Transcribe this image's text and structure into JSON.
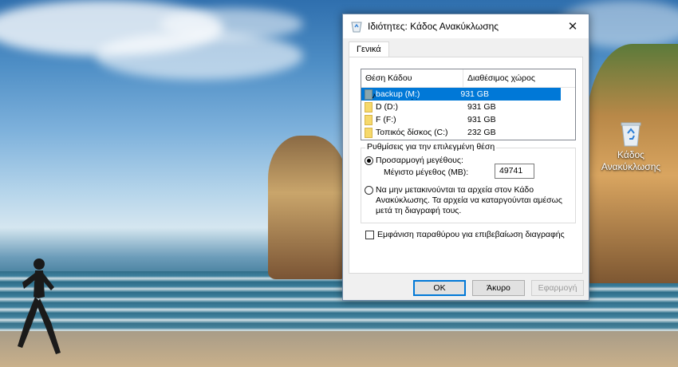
{
  "desktop": {
    "recycle_bin_icon_label": "Κάδος Ανακύκλωσης"
  },
  "dialog": {
    "title": "Ιδιότητες: Κάδος Ανακύκλωσης",
    "tab_general": "Γενικά",
    "list": {
      "col_location": "Θέση Κάδου Ανακύκλωσης",
      "col_space": "Διαθέσιμος χώρος",
      "rows": [
        {
          "name": "backup (M:)",
          "space": "931 GB",
          "selected": true
        },
        {
          "name": "D (D:)",
          "space": "931 GB",
          "selected": false
        },
        {
          "name": "F (F:)",
          "space": "931 GB",
          "selected": false
        },
        {
          "name": "Τοπικός δίσκος (C:)",
          "space": "232 GB",
          "selected": false
        }
      ]
    },
    "settings": {
      "group_title": "Ρυθμίσεις για την επιλεγμένη θέση",
      "custom_size_label": "Προσαρμογή μεγέθους:",
      "max_size_label": "Μέγιστο μέγεθος (MB):",
      "max_size_value": "49741",
      "no_move_label": "Να μην μετακινούνται τα αρχεία στον Κάδο Ανακύκλωσης. Τα αρχεία να καταργούνται αμέσως μετά τη διαγραφή τους.",
      "custom_size_selected": true
    },
    "confirm_delete_label": "Εμφάνιση παραθύρου για επιβεβαίωση διαγραφής",
    "confirm_delete_checked": false,
    "buttons": {
      "ok": "OK",
      "cancel": "Άκυρο",
      "apply": "Εφαρμογή"
    }
  }
}
